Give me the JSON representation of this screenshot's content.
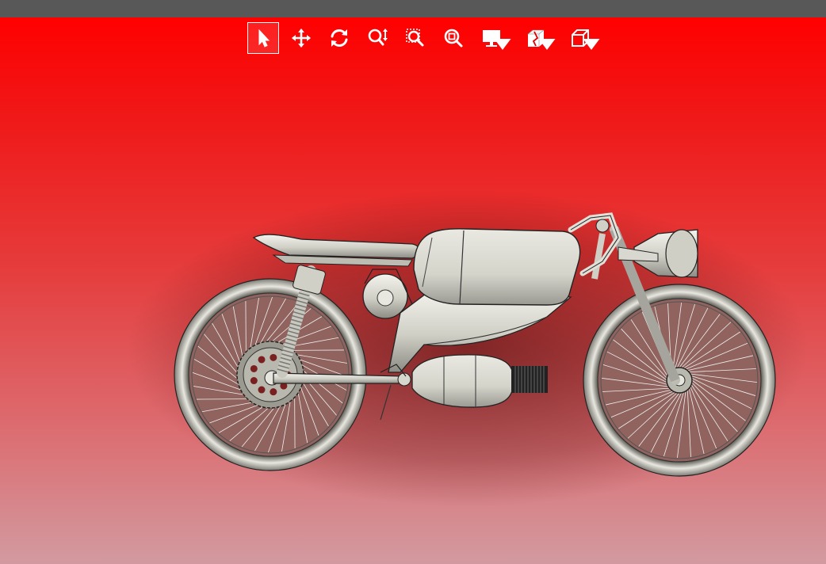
{
  "window": {
    "titlebar_color": "#585858"
  },
  "viewport": {
    "background_top": "#ff0000",
    "background_bottom": "#d29aa0"
  },
  "toolbar": {
    "tools": [
      {
        "name": "select",
        "icon": "cursor-arrow-icon",
        "active": true
      },
      {
        "name": "pan",
        "icon": "move-arrows-icon",
        "active": false
      },
      {
        "name": "rotate",
        "icon": "rotate-icon",
        "active": false
      },
      {
        "name": "zoom",
        "icon": "zoom-updown-icon",
        "active": false
      },
      {
        "name": "zoom-window",
        "icon": "zoom-window-icon",
        "active": false
      },
      {
        "name": "zoom-fit",
        "icon": "zoom-fit-icon",
        "active": false
      },
      {
        "name": "display-mode",
        "icon": "monitor-icon",
        "has_dropdown": true
      },
      {
        "name": "section-view",
        "icon": "section-box-icon",
        "has_dropdown": true
      },
      {
        "name": "view-orientation",
        "icon": "cube-icon",
        "has_dropdown": true
      }
    ]
  },
  "model": {
    "subject": "motorcycle-model",
    "part_color": "#d8d8d0"
  }
}
